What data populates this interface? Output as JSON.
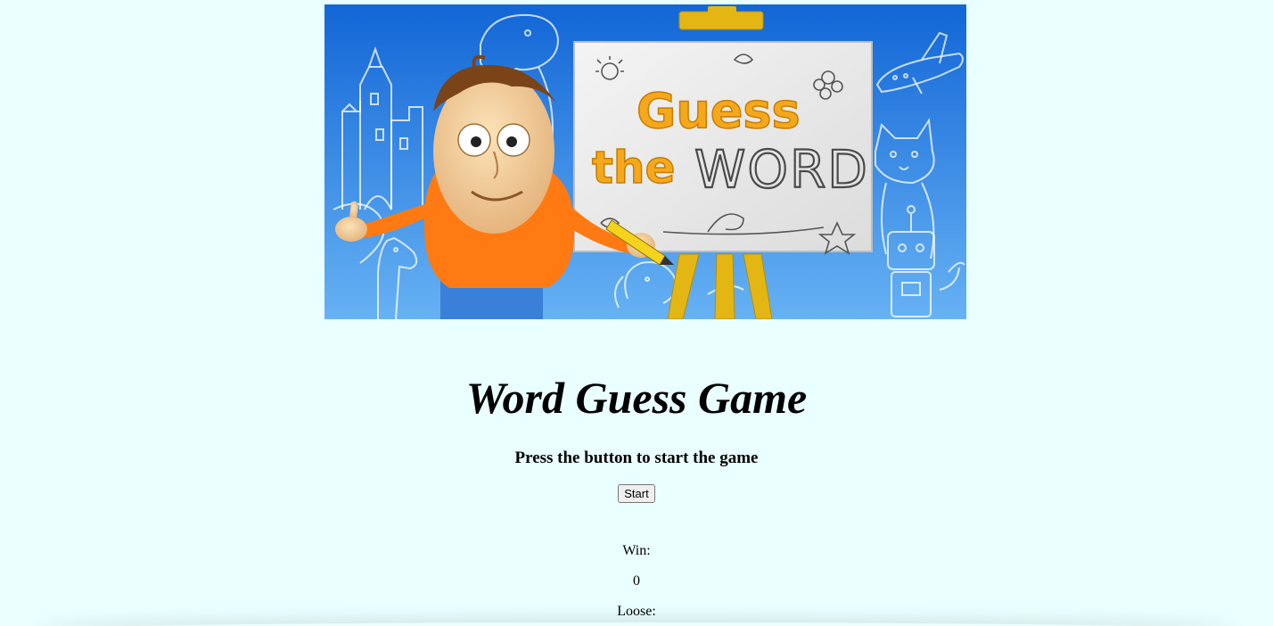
{
  "banner": {
    "logo_line1": "Guess",
    "logo_line2_a": "the",
    "logo_line2_b": "WORD"
  },
  "game": {
    "title": "Word Guess Game",
    "instructions": "Press the button to start the game",
    "start_label": "Start"
  },
  "scores": {
    "win_label": "Win:",
    "win_value": "0",
    "loose_label": "Loose:"
  },
  "colors": {
    "page_background": "#eaffff",
    "banner_sky_top": "#1266d6",
    "banner_sky_bottom": "#67b2f4",
    "logo_orange": "#f5a81c",
    "easel_yellow": "#e4b614"
  }
}
